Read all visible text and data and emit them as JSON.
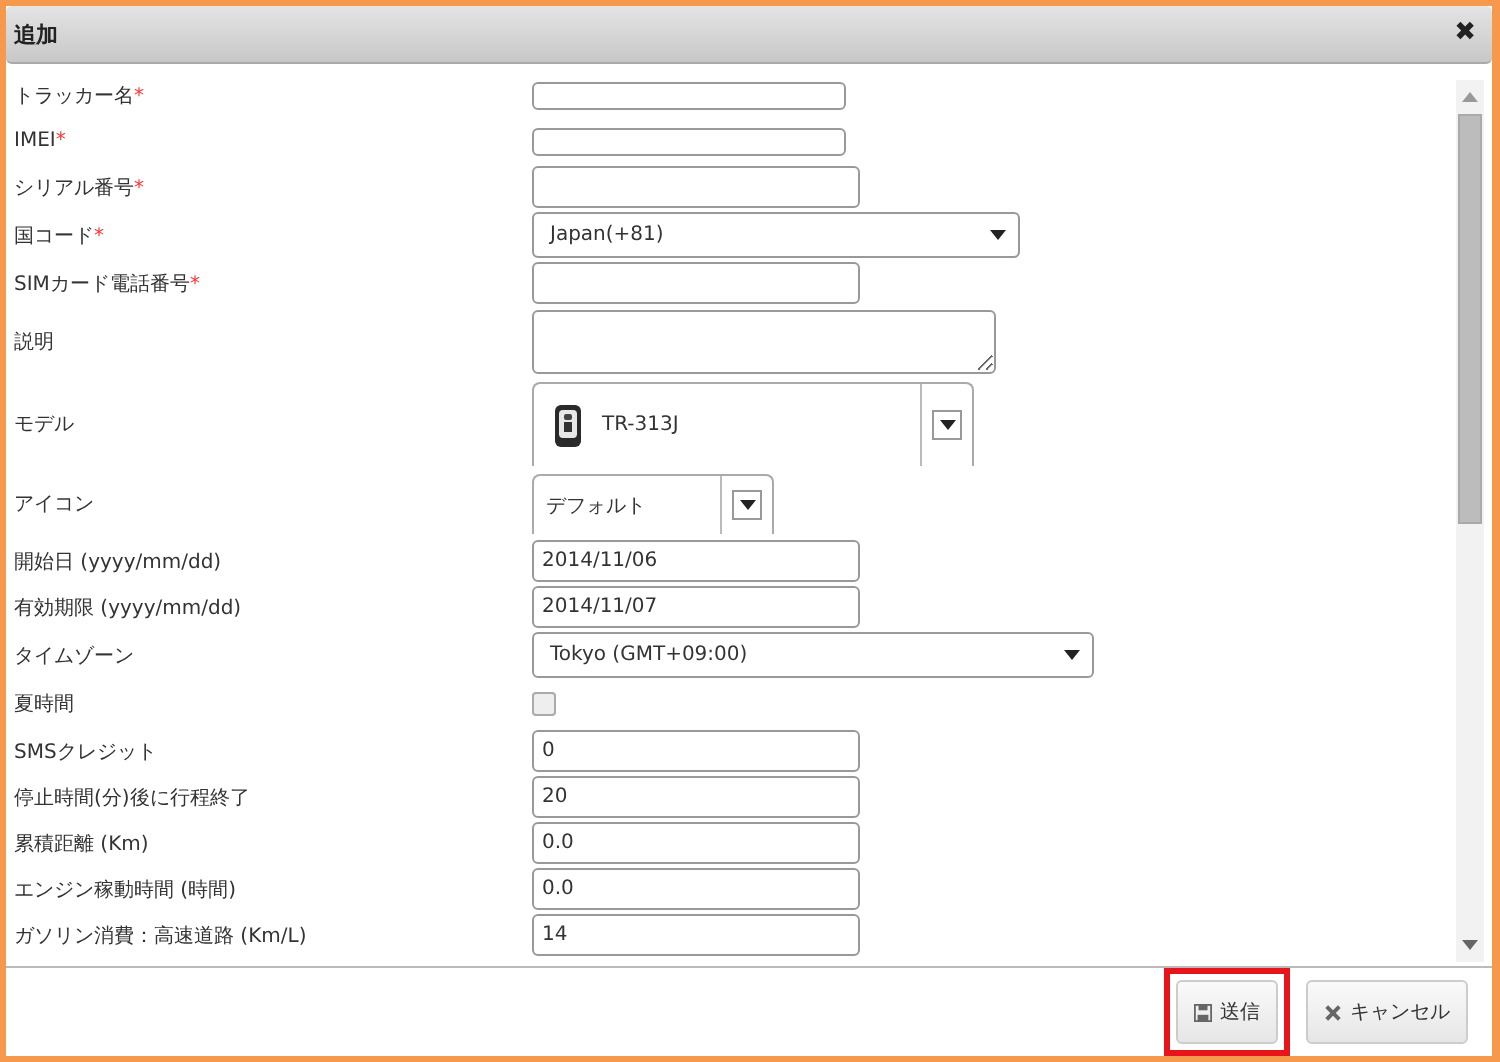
{
  "dialog": {
    "title": "追加",
    "close_icon": "✖"
  },
  "fields": [
    {
      "label": "トラッカー名",
      "required_mark": "*",
      "kind": "short"
    },
    {
      "label": "IMEI",
      "required_mark": "*",
      "kind": "short"
    },
    {
      "label": "シリアル番号",
      "required_mark": "*",
      "kind": "text"
    },
    {
      "label": "国コード",
      "required_mark": "*",
      "kind": "select",
      "value": "Japan(+81)"
    },
    {
      "label": "SIMカード電話番号",
      "required_mark": "*",
      "kind": "text"
    },
    {
      "label": "説明",
      "kind": "textarea"
    },
    {
      "label": "モデル",
      "kind": "model",
      "value": "TR-313J"
    },
    {
      "label": "アイコン",
      "kind": "iconselect",
      "value": "デフォルト"
    },
    {
      "label": "開始日 (yyyy/mm/dd)",
      "kind": "text",
      "value": "2014/11/06"
    },
    {
      "label": "有効期限 (yyyy/mm/dd)",
      "kind": "text",
      "value": "2014/11/07"
    },
    {
      "label": "タイムゾーン",
      "kind": "wideselect",
      "value": "Tokyo (GMT+09:00)"
    },
    {
      "label": "夏時間",
      "kind": "checkbox",
      "checked": false
    },
    {
      "label": "SMSクレジット",
      "kind": "text",
      "value": "0"
    },
    {
      "label": "停止時間(分)後に行程終了",
      "kind": "text",
      "value": "20"
    },
    {
      "label": "累積距離 (Km)",
      "kind": "text",
      "value": "0.0"
    },
    {
      "label": "エンジン稼動時間 (時間)",
      "kind": "text",
      "value": "0.0"
    },
    {
      "label": "ガソリン消費：高速道路 (Km/L)",
      "kind": "text",
      "value": "14"
    }
  ],
  "buttons": [
    {
      "label": "送信",
      "kind": "save",
      "highlighted": true
    },
    {
      "label": "キャンセル",
      "kind": "cancel",
      "highlighted": false
    }
  ]
}
